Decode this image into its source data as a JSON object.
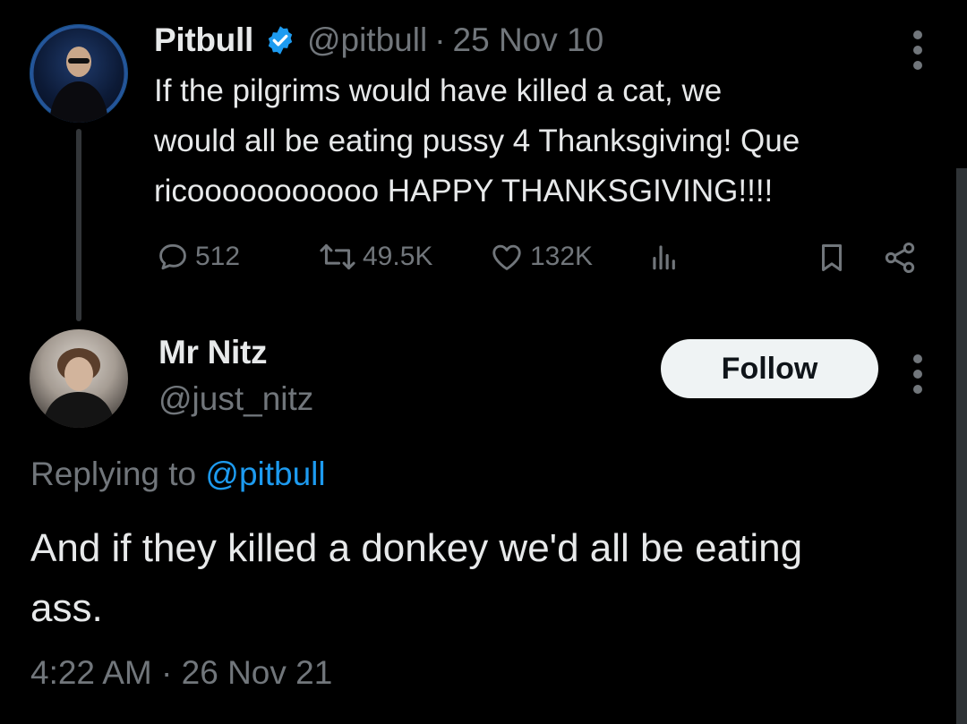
{
  "parent_tweet": {
    "author_name": "Pitbull",
    "handle": "@pitbull",
    "separator": "·",
    "date": "25 Nov 10",
    "text_lines": [
      "If the pilgrims would have killed a cat, we",
      "would all be eating pussy 4 Thanksgiving!  Que",
      "ricooooooooooo HAPPY THANKSGIVING!!!!"
    ],
    "replies": "512",
    "retweets": "49.5K",
    "likes": "132K",
    "icons": [
      "reply-icon",
      "retweet-icon",
      "like-icon",
      "views-icon",
      "bookmark-icon",
      "share-icon",
      "more-icon"
    ]
  },
  "reply_tweet": {
    "author_name": "Mr Nitz",
    "handle": "@just_nitz",
    "follow_label": "Follow",
    "replying_prefix": "Replying to",
    "replying_mention": "@pitbull",
    "text_lines": [
      "And if they killed a donkey we'd all be eating",
      "ass."
    ],
    "time": "4:22 AM",
    "separator": "·",
    "date": "26 Nov 21"
  },
  "colors": {
    "background": "#000000",
    "primary_text": "#e7e9ea",
    "secondary_text": "#71767b",
    "accent": "#1d9bf0",
    "follow_bg": "#eff3f4"
  }
}
